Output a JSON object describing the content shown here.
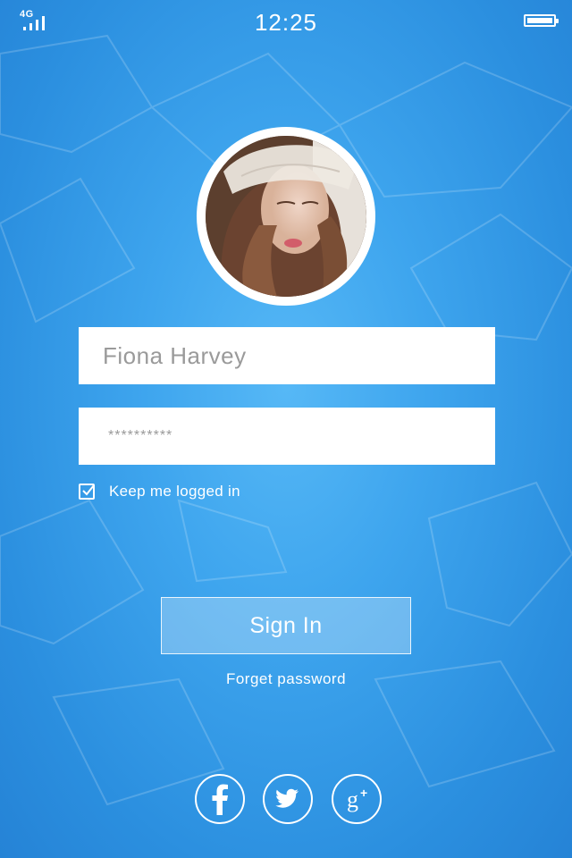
{
  "status_bar": {
    "network": "4G",
    "time": "12:25",
    "icons": [
      "signal-icon",
      "battery-icon"
    ]
  },
  "profile": {
    "avatar_icon": "profile-photo"
  },
  "form": {
    "username_value": "Fiona Harvey",
    "password_value": "**********",
    "remember_label": "Keep me logged in",
    "remember_checked": true,
    "signin_label": "Sign In",
    "forgot_label": "Forget password"
  },
  "social": {
    "icons": [
      "facebook-icon",
      "twitter-icon",
      "google-plus-icon"
    ]
  },
  "colors": {
    "background": "#3ea5ee",
    "accent": "#ffffff"
  }
}
